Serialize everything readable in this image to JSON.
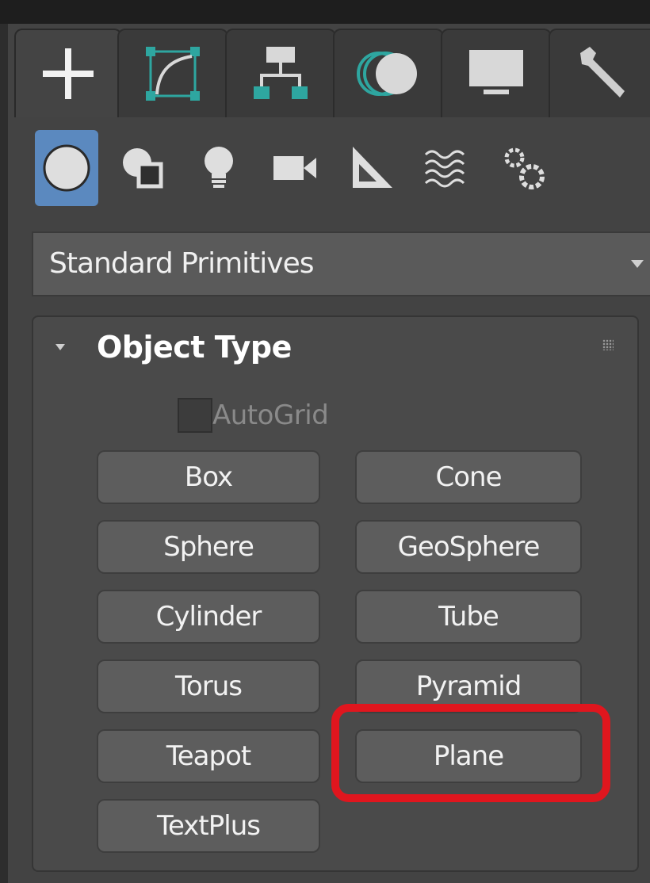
{
  "tabs": [
    {
      "icon": "plus-create-icon",
      "active": true
    },
    {
      "icon": "modify-curve-icon",
      "active": false
    },
    {
      "icon": "hierarchy-icon",
      "active": false
    },
    {
      "icon": "motion-icon",
      "active": false
    },
    {
      "icon": "display-monitor-icon",
      "active": false
    },
    {
      "icon": "utilities-wrench-icon",
      "active": false
    }
  ],
  "categories": [
    {
      "icon": "geometry-sphere-icon",
      "active": true
    },
    {
      "icon": "shapes-icon",
      "active": false
    },
    {
      "icon": "lights-bulb-icon",
      "active": false
    },
    {
      "icon": "cameras-icon",
      "active": false
    },
    {
      "icon": "helpers-ruler-icon",
      "active": false
    },
    {
      "icon": "spacewarps-waves-icon",
      "active": false
    },
    {
      "icon": "systems-gears-icon",
      "active": false
    }
  ],
  "dropdown": {
    "selected": "Standard Primitives"
  },
  "rollout": {
    "title": "Object Type",
    "autogrid_label": "AutoGrid",
    "buttons": [
      "Box",
      "Cone",
      "Sphere",
      "GeoSphere",
      "Cylinder",
      "Tube",
      "Torus",
      "Pyramid",
      "Teapot",
      "Plane",
      "TextPlus"
    ],
    "highlighted": "Plane"
  },
  "colors": {
    "background": "#434343",
    "active_category": "#5b89bf",
    "highlight": "#e0161e",
    "teal_icon": "#2ea6a0"
  }
}
